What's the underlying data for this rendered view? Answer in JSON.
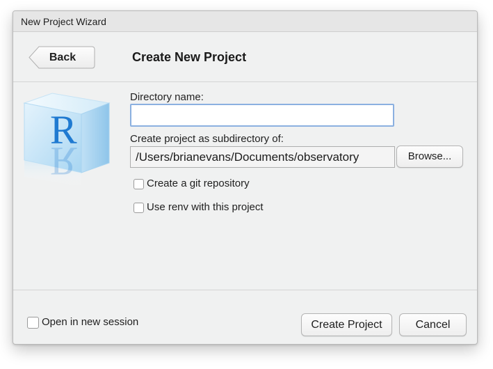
{
  "window": {
    "title": "New Project Wizard"
  },
  "header": {
    "back_label": "Back",
    "title": "Create New Project"
  },
  "logo": {
    "letter": "R",
    "accent_color": "#1f7ad1",
    "cube_color": "#bfe0f5"
  },
  "form": {
    "directory_name_label": "Directory name:",
    "directory_name_value": "",
    "subdirectory_label": "Create project as subdirectory of:",
    "subdirectory_path": "/Users/brianevans/Documents/observatory",
    "browse_label": "Browse...",
    "options": [
      {
        "label": "Create a git repository",
        "checked": false
      },
      {
        "label": "Use renv with this project",
        "checked": false
      }
    ]
  },
  "footer": {
    "open_new_session_label": "Open in new session",
    "open_new_session_checked": false,
    "create_label": "Create Project",
    "cancel_label": "Cancel"
  }
}
